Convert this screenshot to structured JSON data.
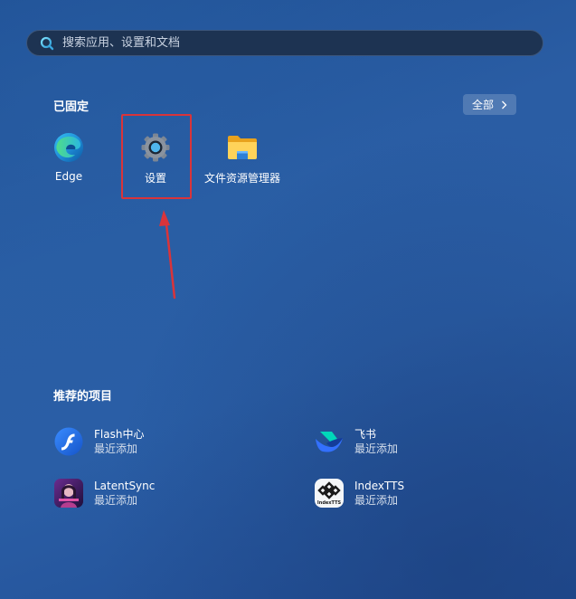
{
  "search": {
    "placeholder": "搜索应用、设置和文档"
  },
  "pinned": {
    "title": "已固定",
    "all_button_label": "全部",
    "apps": [
      {
        "label": "Edge",
        "icon": "edge-icon"
      },
      {
        "label": "设置",
        "icon": "gear-icon"
      },
      {
        "label": "文件资源管理器",
        "icon": "folder-icon"
      }
    ]
  },
  "recommended": {
    "title": "推荐的项目",
    "items": [
      {
        "name": "Flash中心",
        "subtitle": "最近添加",
        "icon": "flash-icon"
      },
      {
        "name": "飞书",
        "subtitle": "最近添加",
        "icon": "feishu-icon"
      },
      {
        "name": "LatentSync",
        "subtitle": "最近添加",
        "icon": "latentsync-icon"
      },
      {
        "name": "IndexTTS",
        "subtitle": "最近添加",
        "icon": "indextts-icon",
        "icon_text": "IndexTTS"
      }
    ]
  },
  "colors": {
    "annotation": "#d9343a",
    "background": "#2a5ea6",
    "search_bg": "#1d3352"
  }
}
